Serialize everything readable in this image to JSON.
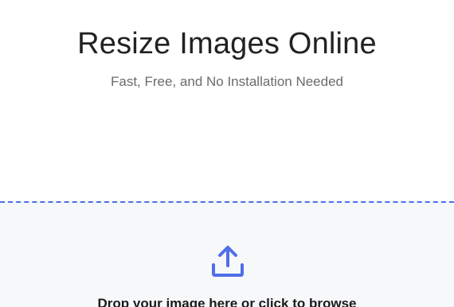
{
  "header": {
    "title": "Resize Images Online",
    "subtitle": "Fast, Free, and No Installation Needed"
  },
  "dropzone": {
    "icon": "upload-icon",
    "label": "Drop your image here or click to browse",
    "accent_color": "#4f6fe8"
  }
}
